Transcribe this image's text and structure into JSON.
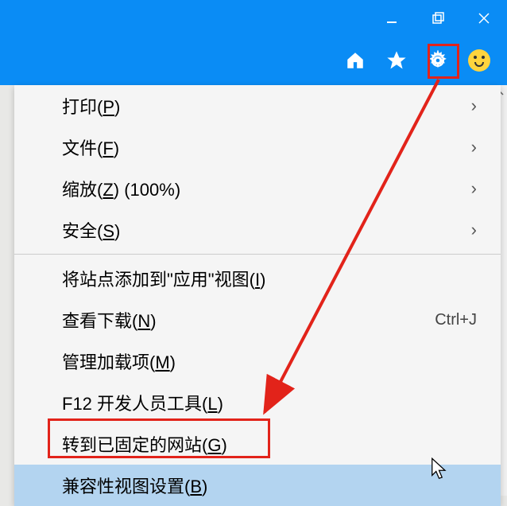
{
  "titlebar": {
    "minimize": "minimize",
    "maximize": "maximize",
    "close": "close"
  },
  "toolbar": {
    "home": "home",
    "favorites": "favorites",
    "tools": "tools",
    "smiley": "smiley"
  },
  "menu": {
    "items": [
      {
        "label": "打印(P)",
        "hotkey": "P",
        "has_submenu": true
      },
      {
        "label": "文件(F)",
        "hotkey": "F",
        "has_submenu": true
      },
      {
        "label": "缩放(Z) (100%)",
        "hotkey": "Z",
        "has_submenu": true
      },
      {
        "label": "安全(S)",
        "hotkey": "S",
        "has_submenu": true
      },
      {
        "sep": true
      },
      {
        "label": "将站点添加到\"应用\"视图(I)",
        "hotkey": "I"
      },
      {
        "label": "查看下载(N)",
        "hotkey": "N",
        "shortcut": "Ctrl+J"
      },
      {
        "label": "管理加载项(M)",
        "hotkey": "M"
      },
      {
        "label": "F12 开发人员工具(L)",
        "hotkey": "L"
      },
      {
        "label": "转到已固定的网站(G)",
        "hotkey": "G"
      },
      {
        "label": "兼容性视图设置(B)",
        "hotkey": "B",
        "highlighted": true
      }
    ]
  },
  "annotations": {
    "highlight_color": "#e2231a"
  }
}
